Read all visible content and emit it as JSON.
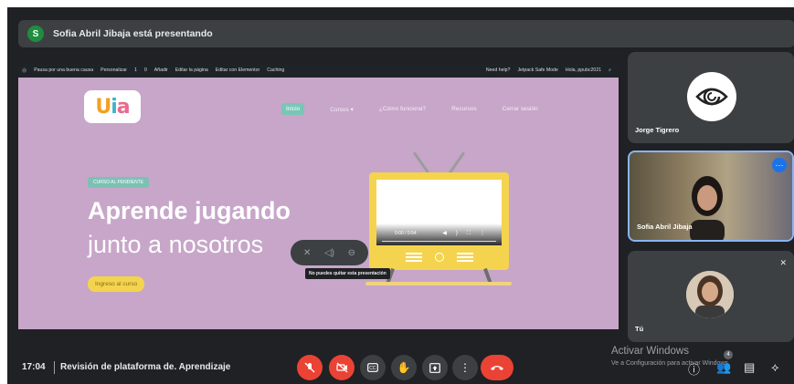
{
  "banner": {
    "avatar_letter": "S",
    "text": "Sofia Abril Jibaja está presentando"
  },
  "wp_admin_bar": {
    "items": [
      "Pausa por una buena causa",
      "Personalizar",
      "1",
      "0",
      "Añadir",
      "Editar la página",
      "Editar con Elementor",
      "Caching"
    ],
    "right_items": [
      "Need help?",
      "Jetpack Safe Mode",
      "Hola, ppubc2021"
    ]
  },
  "site": {
    "logo": [
      "U",
      "i",
      "a"
    ],
    "nav": [
      "Inicio",
      "Cursos ▾",
      "¿Cómo funciona?",
      "Recursos",
      "Cerrar sesión"
    ],
    "chip": "CURSO AL PENDIENTE",
    "heading_line1": "Aprende jugando",
    "heading_line2": "junto a nosotros",
    "cta": "Ingreso al curso",
    "video_time": "0:00 / 0:54"
  },
  "presentation_overlay": {
    "tooltip": "No puedes quitar esta presentación"
  },
  "participants": [
    {
      "name": "Jorge Tigrero"
    },
    {
      "name": "Sofia Abril Jibaja"
    },
    {
      "name": "Tú"
    }
  ],
  "bottom_bar": {
    "time": "17:04",
    "meeting_title": "Revisión de plataforma de. Aprendizaje",
    "people_badge": "4"
  },
  "windows_watermark": {
    "line1": "Activar Windows",
    "line2": "Ve a Configuración para activar Windows."
  },
  "colors": {
    "meet_bg": "#202124",
    "tile_bg": "#3c4043",
    "red": "#ea4335",
    "site_bg": "#c7a6c9"
  }
}
